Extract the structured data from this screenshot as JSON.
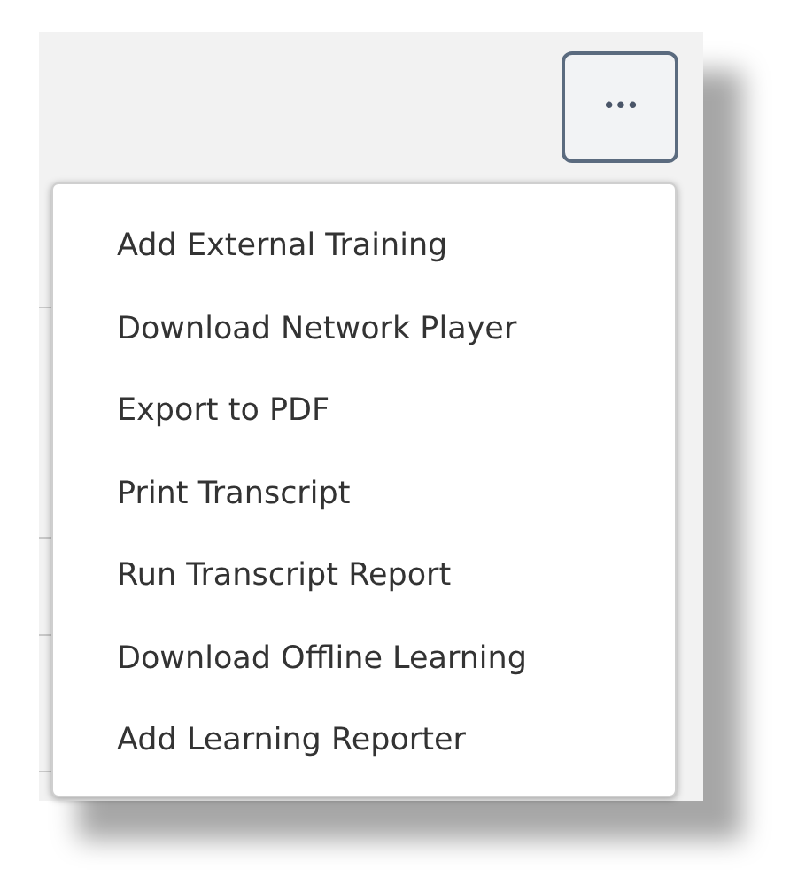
{
  "more_button": {
    "label": "•••"
  },
  "menu": {
    "items": [
      {
        "label": "Add External Training"
      },
      {
        "label": "Download Network Player"
      },
      {
        "label": "Export to PDF"
      },
      {
        "label": "Print Transcript"
      },
      {
        "label": "Run Transcript Report"
      },
      {
        "label": "Download Offline Learning"
      },
      {
        "label": "Add Learning Reporter"
      }
    ]
  }
}
